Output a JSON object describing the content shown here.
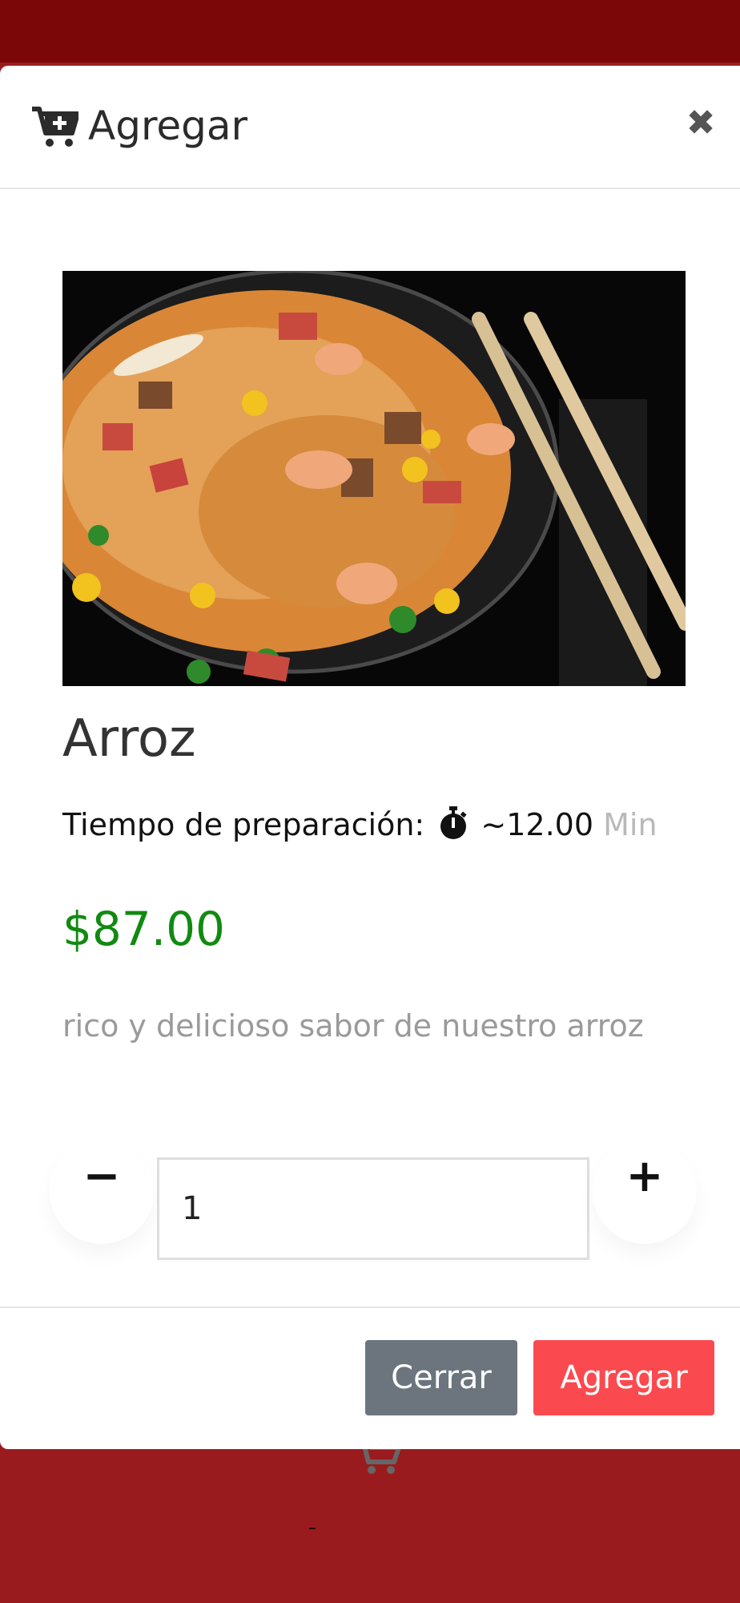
{
  "modal": {
    "title": "Agregar",
    "close_symbol": "✖",
    "icons": {
      "header": "cart-plus-icon",
      "close": "close-icon",
      "prep": "stopwatch-icon",
      "background": "shopping-cart-icon"
    }
  },
  "product": {
    "image_alt": "Arroz",
    "name": "Arroz",
    "prep_label": "Tiempo de preparación:",
    "prep_time": "~12.00",
    "prep_unit": "Min",
    "price": "$87.00",
    "description": "rico y delicioso sabor de nuestro arroz"
  },
  "quantity": {
    "minus_symbol": "−",
    "plus_symbol": "+",
    "value": "1"
  },
  "footer": {
    "close_label": "Cerrar",
    "add_label": "Agregar"
  },
  "colors": {
    "backdrop": "#9a1b1e",
    "top_bar": "#7b0709",
    "price": "#118a11",
    "close_button": "#6c757d",
    "add_button": "#fb4a4f"
  }
}
